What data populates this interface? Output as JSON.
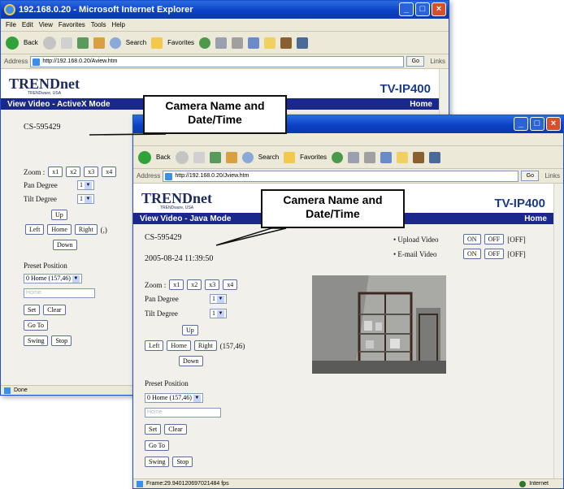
{
  "back_window": {
    "title": "192.168.0.20 - Microsoft Internet Explorer",
    "menu": [
      "File",
      "Edit",
      "View",
      "Favorites",
      "Tools",
      "Help"
    ],
    "toolbar": {
      "back": "Back",
      "search": "Search",
      "favorites": "Favorites"
    },
    "address_label": "Address",
    "address_url": "http://192.168.0.20/Aview.htm",
    "go": "Go",
    "links": "Links",
    "logo": "TRENDnet",
    "logo_sub": "TRENDware, USA",
    "model": "TV-IP400",
    "mode_title": "View Video - ActiveX Mode",
    "home": "Home",
    "camera_name": "CS-595429",
    "zoom_label": "Zoom :",
    "zoom_buttons": [
      "x1",
      "x2",
      "x3",
      "x4"
    ],
    "pan_label": "Pan Degree",
    "pan_value": "1",
    "tilt_label": "Tilt Degree",
    "tilt_value": "1",
    "up": "Up",
    "left": "Left",
    "home_btn": "Home",
    "right": "Right",
    "coords": "(,)",
    "down": "Down",
    "preset_label": "Preset Position",
    "preset_value": "0 Home (157,46)",
    "preset_placeholder": "Home",
    "set": "Set",
    "clear": "Clear",
    "goto": "Go To",
    "swing": "Swing",
    "stop": "Stop",
    "status": "Done"
  },
  "front_window": {
    "toolbar": {
      "back": "Back",
      "search": "Search",
      "favorites": "Favorites"
    },
    "address_label": "Address",
    "address_url": "http://192.168.0.20/Jview.htm",
    "go": "Go",
    "links": "Links",
    "logo": "TRENDnet",
    "logo_sub": "TRENDware, USA",
    "model": "TV-IP400",
    "mode_title": "View Video - Java Mode",
    "home": "Home",
    "camera_name": "CS-595429",
    "datetime": "2005-08-24 11:39:50",
    "upload_label": "Upload Video",
    "email_label": "E-mail Video",
    "on": "ON",
    "off": "OFF",
    "off_state": "[OFF]",
    "zoom_label": "Zoom :",
    "zoom_buttons": [
      "x1",
      "x2",
      "x3",
      "x4"
    ],
    "pan_label": "Pan Degree",
    "pan_value": "1",
    "tilt_label": "Tilt Degree",
    "tilt_value": "1",
    "up": "Up",
    "left": "Left",
    "home_btn": "Home",
    "right": "Right",
    "coords": "(157,46)",
    "down": "Down",
    "preset_label": "Preset Position",
    "preset_value": "0 Home (157,46)",
    "preset_placeholder": "Home",
    "set": "Set",
    "clear": "Clear",
    "goto": "Go To",
    "swing": "Swing",
    "stop": "Stop",
    "status": "Frame:29.940120697021484 fps",
    "zone": "Internet"
  },
  "callouts": {
    "first": "Camera Name and Date/Time",
    "second": "Camera Name and Date/Time"
  }
}
